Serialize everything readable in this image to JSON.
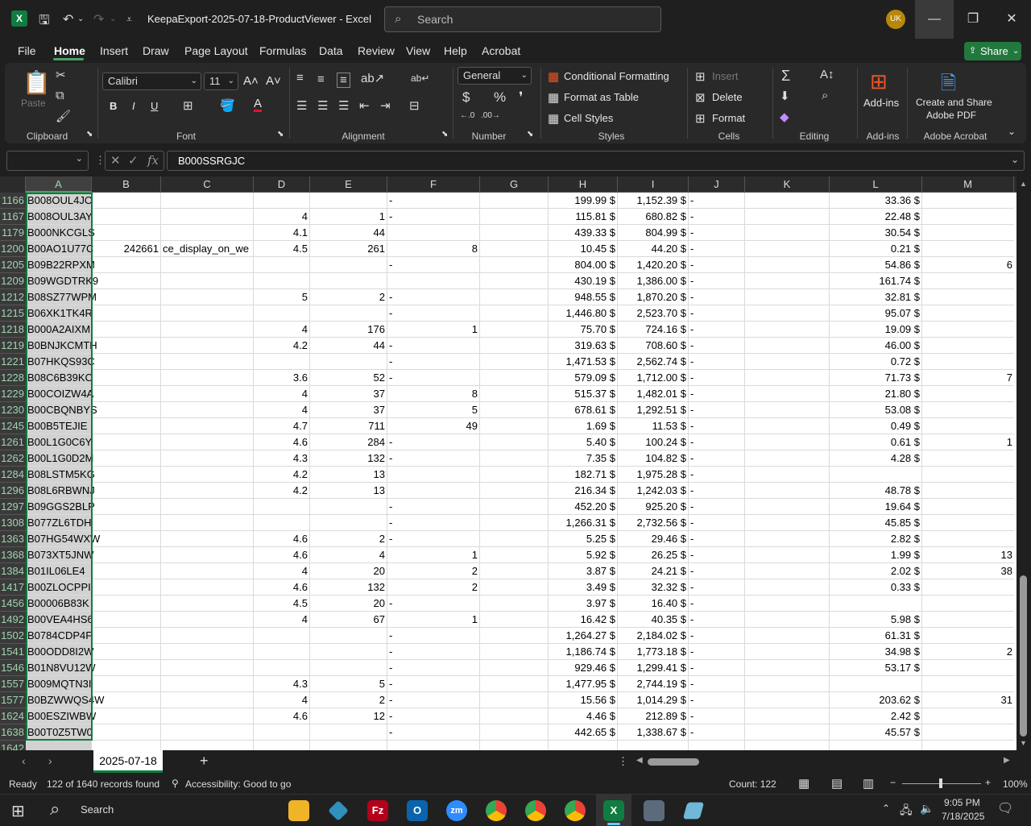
{
  "window": {
    "title": "KeepaExport-2025-07-18-ProductViewer  -  Excel",
    "search_placeholder": "Search",
    "avatar_initials": "UK"
  },
  "menu": {
    "items": [
      "File",
      "Home",
      "Insert",
      "Draw",
      "Page Layout",
      "Formulas",
      "Data",
      "Review",
      "View",
      "Help",
      "Acrobat"
    ],
    "share_label": "Share"
  },
  "ribbon": {
    "clipboard": {
      "paste": "Paste",
      "label": "Clipboard"
    },
    "font": {
      "name": "Calibri",
      "size": "11",
      "bold": "B",
      "italic": "I",
      "underline": "U",
      "label": "Font"
    },
    "alignment": {
      "label": "Alignment"
    },
    "number": {
      "format": "General",
      "label": "Number"
    },
    "styles": {
      "conditional": "Conditional Formatting",
      "format_table": "Format as Table",
      "cell_styles": "Cell Styles",
      "label": "Styles"
    },
    "cells": {
      "insert": "Insert",
      "delete": "Delete",
      "format": "Format",
      "label": "Cells"
    },
    "editing": {
      "label": "Editing"
    },
    "addins": {
      "button": "Add-ins",
      "label": "Add-ins"
    },
    "acrobat": {
      "line1": "Create and Share",
      "line2": "Adobe PDF",
      "label": "Adobe Acrobat"
    }
  },
  "formula": {
    "fx": "fx",
    "content": "B000SSRGJC"
  },
  "columns": [
    "A",
    "B",
    "C",
    "D",
    "E",
    "F",
    "G",
    "H",
    "I",
    "J",
    "K",
    "L",
    "M"
  ],
  "rows": [
    {
      "n": "1166",
      "a": "B008OUL4JO",
      "b": "",
      "c": "",
      "d": "",
      "e": "",
      "f": "-",
      "g": "",
      "h": "199.99 $",
      "i": "1,152.39 $",
      "j": "-",
      "k": "",
      "l": "33.36 $",
      "m": ""
    },
    {
      "n": "1167",
      "a": "B008OUL3AY",
      "b": "",
      "c": "",
      "d": "4",
      "e": "1",
      "f": "-",
      "g": "",
      "h": "115.81 $",
      "i": "680.82 $",
      "j": "-",
      "k": "",
      "l": "22.48 $",
      "m": ""
    },
    {
      "n": "1179",
      "a": "B000NKCGLS",
      "b": "",
      "c": "",
      "d": "4.1",
      "e": "44",
      "f": "",
      "g": "",
      "h": "439.33 $",
      "i": "804.99 $",
      "j": "-",
      "k": "",
      "l": "30.54 $",
      "m": ""
    },
    {
      "n": "1200",
      "a": "B00AO1U77C",
      "b": "242661",
      "c": "ce_display_on_we",
      "d": "4.5",
      "e": "261",
      "f": "8",
      "g": "",
      "h": "10.45 $",
      "i": "44.20 $",
      "j": "-",
      "k": "",
      "l": "0.21 $",
      "m": ""
    },
    {
      "n": "1205",
      "a": "B09B22RPXM",
      "b": "",
      "c": "",
      "d": "",
      "e": "",
      "f": "-",
      "g": "",
      "h": "804.00 $",
      "i": "1,420.20 $",
      "j": "-",
      "k": "",
      "l": "54.86 $",
      "m": "6"
    },
    {
      "n": "1209",
      "a": "B09WGDTRK9",
      "b": "",
      "c": "",
      "d": "",
      "e": "",
      "f": "",
      "g": "",
      "h": "430.19 $",
      "i": "1,386.00 $",
      "j": "-",
      "k": "",
      "l": "161.74 $",
      "m": ""
    },
    {
      "n": "1212",
      "a": "B08SZ77WPM",
      "b": "",
      "c": "",
      "d": "5",
      "e": "2",
      "f": "-",
      "g": "",
      "h": "948.55 $",
      "i": "1,870.20 $",
      "j": "-",
      "k": "",
      "l": "32.81 $",
      "m": ""
    },
    {
      "n": "1215",
      "a": "B06XK1TK4R",
      "b": "",
      "c": "",
      "d": "",
      "e": "",
      "f": "-",
      "g": "",
      "h": "1,446.80 $",
      "i": "2,523.70 $",
      "j": "-",
      "k": "",
      "l": "95.07 $",
      "m": ""
    },
    {
      "n": "1218",
      "a": "B000A2AIXM",
      "b": "",
      "c": "",
      "d": "4",
      "e": "176",
      "f": "1",
      "g": "",
      "h": "75.70 $",
      "i": "724.16 $",
      "j": "-",
      "k": "",
      "l": "19.09 $",
      "m": ""
    },
    {
      "n": "1219",
      "a": "B0BNJKCMTH",
      "b": "",
      "c": "",
      "d": "4.2",
      "e": "44",
      "f": "-",
      "g": "",
      "h": "319.63 $",
      "i": "708.60 $",
      "j": "-",
      "k": "",
      "l": "46.00 $",
      "m": ""
    },
    {
      "n": "1221",
      "a": "B07HKQS93C",
      "b": "",
      "c": "",
      "d": "",
      "e": "",
      "f": "-",
      "g": "",
      "h": "1,471.53 $",
      "i": "2,562.74 $",
      "j": "-",
      "k": "",
      "l": "0.72 $",
      "m": ""
    },
    {
      "n": "1228",
      "a": "B08C6B39KC",
      "b": "",
      "c": "",
      "d": "3.6",
      "e": "52",
      "f": "-",
      "g": "",
      "h": "579.09 $",
      "i": "1,712.00 $",
      "j": "-",
      "k": "",
      "l": "71.73 $",
      "m": "7"
    },
    {
      "n": "1229",
      "a": "B00COIZW4A",
      "b": "",
      "c": "",
      "d": "4",
      "e": "37",
      "f": "8",
      "g": "",
      "h": "515.37 $",
      "i": "1,482.01 $",
      "j": "-",
      "k": "",
      "l": "21.80 $",
      "m": ""
    },
    {
      "n": "1230",
      "a": "B00CBQNBYS",
      "b": "",
      "c": "",
      "d": "4",
      "e": "37",
      "f": "5",
      "g": "",
      "h": "678.61 $",
      "i": "1,292.51 $",
      "j": "-",
      "k": "",
      "l": "53.08 $",
      "m": ""
    },
    {
      "n": "1245",
      "a": "B00B5TEJIE",
      "b": "",
      "c": "",
      "d": "4.7",
      "e": "711",
      "f": "49",
      "g": "",
      "h": "1.69 $",
      "i": "11.53 $",
      "j": "-",
      "k": "",
      "l": "0.49 $",
      "m": ""
    },
    {
      "n": "1261",
      "a": "B00L1G0C6Y",
      "b": "",
      "c": "",
      "d": "4.6",
      "e": "284",
      "f": "-",
      "g": "",
      "h": "5.40 $",
      "i": "100.24 $",
      "j": "-",
      "k": "",
      "l": "0.61 $",
      "m": "1"
    },
    {
      "n": "1262",
      "a": "B00L1G0D2M",
      "b": "",
      "c": "",
      "d": "4.3",
      "e": "132",
      "f": "-",
      "g": "",
      "h": "7.35 $",
      "i": "104.82 $",
      "j": "-",
      "k": "",
      "l": "4.28 $",
      "m": ""
    },
    {
      "n": "1284",
      "a": "B08LSTM5KG",
      "b": "",
      "c": "",
      "d": "4.2",
      "e": "13",
      "f": "",
      "g": "",
      "h": "182.71 $",
      "i": "1,975.28 $",
      "j": "-",
      "k": "",
      "l": "",
      "m": ""
    },
    {
      "n": "1296",
      "a": "B08L6RBWNJ",
      "b": "",
      "c": "",
      "d": "4.2",
      "e": "13",
      "f": "",
      "g": "",
      "h": "216.34 $",
      "i": "1,242.03 $",
      "j": "-",
      "k": "",
      "l": "48.78 $",
      "m": ""
    },
    {
      "n": "1297",
      "a": "B09GGS2BLP",
      "b": "",
      "c": "",
      "d": "",
      "e": "",
      "f": "-",
      "g": "",
      "h": "452.20 $",
      "i": "925.20 $",
      "j": "-",
      "k": "",
      "l": "19.64 $",
      "m": ""
    },
    {
      "n": "1308",
      "a": "B077ZL6TDH",
      "b": "",
      "c": "",
      "d": "",
      "e": "",
      "f": "-",
      "g": "",
      "h": "1,266.31 $",
      "i": "2,732.56 $",
      "j": "-",
      "k": "",
      "l": "45.85 $",
      "m": ""
    },
    {
      "n": "1363",
      "a": "B07HG54WXW",
      "b": "",
      "c": "",
      "d": "4.6",
      "e": "2",
      "f": "-",
      "g": "",
      "h": "5.25 $",
      "i": "29.46 $",
      "j": "-",
      "k": "",
      "l": "2.82 $",
      "m": ""
    },
    {
      "n": "1368",
      "a": "B073XT5JNW",
      "b": "",
      "c": "",
      "d": "4.6",
      "e": "4",
      "f": "1",
      "g": "",
      "h": "5.92 $",
      "i": "26.25 $",
      "j": "-",
      "k": "",
      "l": "1.99 $",
      "m": "13"
    },
    {
      "n": "1384",
      "a": "B01IL06LE4",
      "b": "",
      "c": "",
      "d": "4",
      "e": "20",
      "f": "2",
      "g": "",
      "h": "3.87 $",
      "i": "24.21 $",
      "j": "-",
      "k": "",
      "l": "2.02 $",
      "m": "38"
    },
    {
      "n": "1417",
      "a": "B00ZLOCPPI",
      "b": "",
      "c": "",
      "d": "4.6",
      "e": "132",
      "f": "2",
      "g": "",
      "h": "3.49 $",
      "i": "32.32 $",
      "j": "-",
      "k": "",
      "l": "0.33 $",
      "m": ""
    },
    {
      "n": "1456",
      "a": "B00006B83K",
      "b": "",
      "c": "",
      "d": "4.5",
      "e": "20",
      "f": "-",
      "g": "",
      "h": "3.97 $",
      "i": "16.40 $",
      "j": "-",
      "k": "",
      "l": "",
      "m": ""
    },
    {
      "n": "1492",
      "a": "B00VEA4HS6",
      "b": "",
      "c": "",
      "d": "4",
      "e": "67",
      "f": "1",
      "g": "",
      "h": "16.42 $",
      "i": "40.35 $",
      "j": "-",
      "k": "",
      "l": "5.98 $",
      "m": ""
    },
    {
      "n": "1502",
      "a": "B0784CDP4F",
      "b": "",
      "c": "",
      "d": "",
      "e": "",
      "f": "-",
      "g": "",
      "h": "1,264.27 $",
      "i": "2,184.02 $",
      "j": "-",
      "k": "",
      "l": "61.31 $",
      "m": ""
    },
    {
      "n": "1541",
      "a": "B00ODD8I2W",
      "b": "",
      "c": "",
      "d": "",
      "e": "",
      "f": "-",
      "g": "",
      "h": "1,186.74 $",
      "i": "1,773.18 $",
      "j": "-",
      "k": "",
      "l": "34.98 $",
      "m": "2"
    },
    {
      "n": "1546",
      "a": "B01N8VU12W",
      "b": "",
      "c": "",
      "d": "",
      "e": "",
      "f": "-",
      "g": "",
      "h": "929.46 $",
      "i": "1,299.41 $",
      "j": "-",
      "k": "",
      "l": "53.17 $",
      "m": ""
    },
    {
      "n": "1557",
      "a": "B009MQTN3I",
      "b": "",
      "c": "",
      "d": "4.3",
      "e": "5",
      "f": "-",
      "g": "",
      "h": "1,477.95 $",
      "i": "2,744.19 $",
      "j": "-",
      "k": "",
      "l": "",
      "m": ""
    },
    {
      "n": "1577",
      "a": "B0BZWWQS4W",
      "b": "",
      "c": "",
      "d": "4",
      "e": "2",
      "f": "-",
      "g": "",
      "h": "15.56 $",
      "i": "1,014.29 $",
      "j": "-",
      "k": "",
      "l": "203.62 $",
      "m": "31"
    },
    {
      "n": "1624",
      "a": "B00ESZIWBW",
      "b": "",
      "c": "",
      "d": "4.6",
      "e": "12",
      "f": "-",
      "g": "",
      "h": "4.46 $",
      "i": "212.89 $",
      "j": "-",
      "k": "",
      "l": "2.42 $",
      "m": ""
    },
    {
      "n": "1638",
      "a": "B00T0Z5TW0",
      "b": "",
      "c": "",
      "d": "",
      "e": "",
      "f": "-",
      "g": "",
      "h": "442.65 $",
      "i": "1,338.67 $",
      "j": "-",
      "k": "",
      "l": "45.57 $",
      "m": ""
    },
    {
      "n": "1642",
      "a": "",
      "b": "",
      "c": "",
      "d": "",
      "e": "",
      "f": "",
      "g": "",
      "h": "",
      "i": "",
      "j": "",
      "k": "",
      "l": "",
      "m": ""
    }
  ],
  "sheet": {
    "tab": "2025-07-18",
    "add": "+"
  },
  "status": {
    "ready": "Ready",
    "records": "122 of 1640 records found",
    "accessibility": "Accessibility: Good to go",
    "count": "Count: 122",
    "zoom": "100%"
  },
  "taskbar": {
    "search": "Search",
    "time": "9:05 PM",
    "date": "7/18/2025"
  }
}
